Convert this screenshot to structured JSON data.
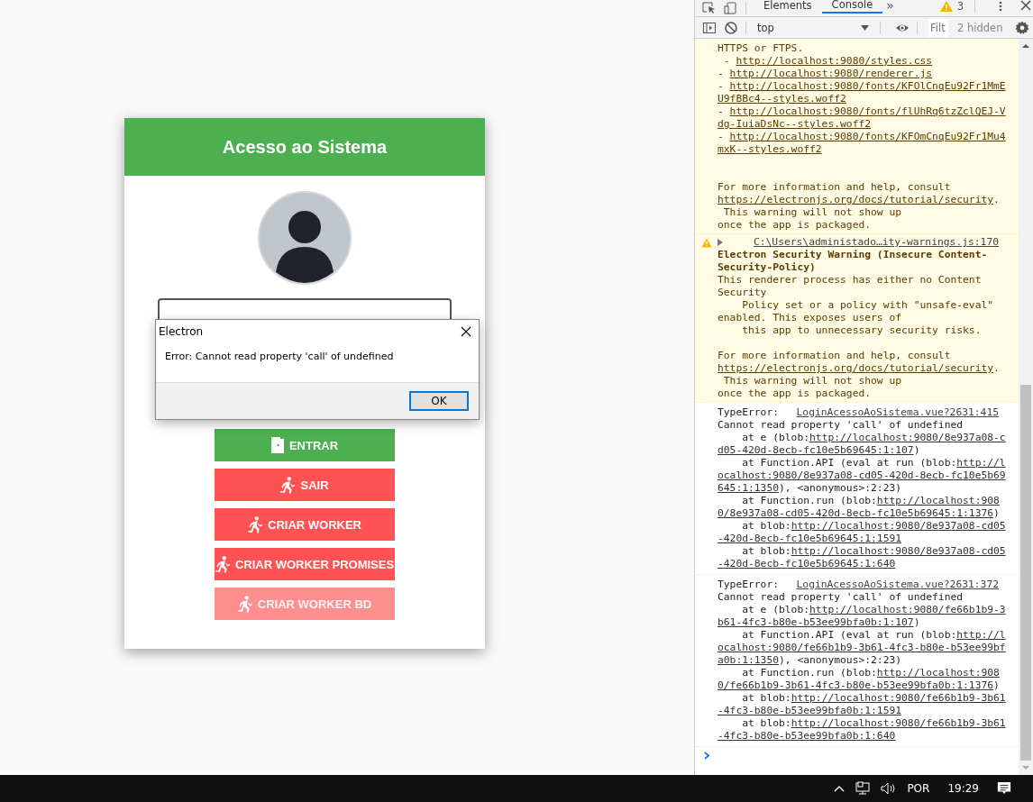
{
  "app": {
    "title": "Acesso ao Sistema",
    "buttons": [
      {
        "label": "ENTRAR",
        "kind": "enter",
        "color": "#4caf50",
        "disabled": false
      },
      {
        "label": "SAIR",
        "kind": "exit",
        "color": "#ff5252",
        "disabled": false
      },
      {
        "label": "CRIAR WORKER",
        "kind": "exit",
        "color": "#ff5252",
        "disabled": false
      },
      {
        "label": "CRIAR WORKER PROMISES",
        "kind": "exit",
        "color": "#ff5252",
        "disabled": false
      },
      {
        "label": "CRIAR WORKER BD",
        "kind": "exit",
        "color": "#ff8e8e",
        "disabled": true
      }
    ]
  },
  "dialog": {
    "title": "Electron",
    "message": "Error: Cannot read property 'call' of undefined",
    "button": "OK"
  },
  "devtools": {
    "tabs": [
      {
        "label": "Elements",
        "selected": false
      },
      {
        "label": "Console",
        "selected": true
      }
    ],
    "more_tabs": "»",
    "warning_count": "3",
    "context": "top",
    "filter": {
      "placeholder": "Filt"
    },
    "hidden": "2 hidden",
    "messages": [
      {
        "kind": "warning",
        "lines": [
          {
            "text": "HTTPS or FTPS."
          },
          {
            "text": " - ",
            "link": "http://localhost:9080/styles.css"
          },
          {
            "text": "- ",
            "link": "http://localhost:9080/renderer.js"
          },
          {
            "text": "- ",
            "link": "http://localhost:9080/fonts/KFOlCnqEu92Fr1MmE"
          },
          {
            "link": "U9fBBc4--styles.woff2"
          },
          {
            "text": "- ",
            "link": "http://localhost:9080/fonts/flUhRq6tzZclQEJ-V"
          },
          {
            "link": "dg-IuiaDsNc--styles.woff2"
          },
          {
            "text": "- ",
            "link": "http://localhost:9080/fonts/KFOmCnqEu92Fr1Mu4"
          },
          {
            "link": "mxK--styles.woff2"
          },
          {
            "kind": "blank"
          },
          {
            "kind": "blank"
          },
          {
            "text": "For more information and help, consult"
          },
          {
            "link": "https://electronjs.org/docs/tutorial/security",
            "after": "."
          },
          {
            "text": " This warning will not show up"
          },
          {
            "text": "once the app is packaged."
          }
        ]
      },
      {
        "kind": "warning",
        "icon": true,
        "expanded": false,
        "source": "C:\\Users\\administado…ity-warnings.js:170",
        "lines": [
          {
            "text": "Electron Security Warning (Insecure Content-",
            "bold": true
          },
          {
            "text": "Security-Policy)",
            "bold": true
          },
          {
            "text": "This renderer process has either no Content"
          },
          {
            "text": "Security"
          },
          {
            "text": "    Policy set or a policy with \"unsafe-eval\""
          },
          {
            "text": "enabled. This exposes users of"
          },
          {
            "text": "    this app to unnecessary security risks."
          },
          {
            "kind": "blank"
          },
          {
            "text": "For more information and help, consult"
          },
          {
            "link": "https://electronjs.org/docs/tutorial/security",
            "after": "."
          },
          {
            "text": " This warning will not show up"
          },
          {
            "text": "once the app is packaged."
          }
        ]
      },
      {
        "kind": "log",
        "label": "TypeError:",
        "source": "LoginAcessoAoSistema.vue?2631:415",
        "lines": [
          {
            "text": "Cannot read property 'call' of undefined"
          },
          {
            "text": "    at e (blob:",
            "link": "http://localhost:9080/8e937a08-c"
          },
          {
            "link": "d05-420d-8ecb-fc10e5b69645:1:107",
            "after": ")"
          },
          {
            "text": "    at Function.API (eval at run (blob:",
            "link": "http://l"
          },
          {
            "link": "ocalhost:9080/8e937a08-cd05-420d-8ecb-fc10e5b69"
          },
          {
            "link": "645:1:1350",
            "after": "), <anonymous>:2:23)"
          },
          {
            "text": "    at Function.run (blob:",
            "link": "http://localhost:908"
          },
          {
            "link": "0/8e937a08-cd05-420d-8ecb-fc10e5b69645:1:1376",
            "after": ")"
          },
          {
            "text": "    at blob:",
            "link": "http://localhost:9080/8e937a08-cd05"
          },
          {
            "link": "-420d-8ecb-fc10e5b69645:1:1591"
          },
          {
            "text": "    at blob:",
            "link": "http://localhost:9080/8e937a08-cd05"
          },
          {
            "link": "-420d-8ecb-fc10e5b69645:1:640"
          }
        ]
      },
      {
        "kind": "log",
        "label": "TypeError:",
        "source": "LoginAcessoAoSistema.vue?2631:372",
        "lines": [
          {
            "text": "Cannot read property 'call' of undefined"
          },
          {
            "text": "    at e (blob:",
            "link": "http://localhost:9080/fe66b1b9-3"
          },
          {
            "link": "b61-4fc3-b80e-b53ee99bfa0b:1:107",
            "after": ")"
          },
          {
            "text": "    at Function.API (eval at run (blob:",
            "link": "http://l"
          },
          {
            "link": "ocalhost:9080/fe66b1b9-3b61-4fc3-b80e-b53ee99bf"
          },
          {
            "link": "a0b:1:1350",
            "after": "), <anonymous>:2:23)"
          },
          {
            "text": "    at Function.run (blob:",
            "link": "http://localhost:908"
          },
          {
            "link": "0/fe66b1b9-3b61-4fc3-b80e-b53ee99bfa0b:1:1376",
            "after": ")"
          },
          {
            "text": "    at blob:",
            "link": "http://localhost:9080/fe66b1b9-3b61"
          },
          {
            "link": "-4fc3-b80e-b53ee99bfa0b:1:1591"
          },
          {
            "text": "    at blob:",
            "link": "http://localhost:9080/fe66b1b9-3b61"
          },
          {
            "link": "-4fc3-b80e-b53ee99bfa0b:1:640"
          }
        ]
      }
    ]
  },
  "taskbar": {
    "language": "POR",
    "time": "19:29"
  }
}
